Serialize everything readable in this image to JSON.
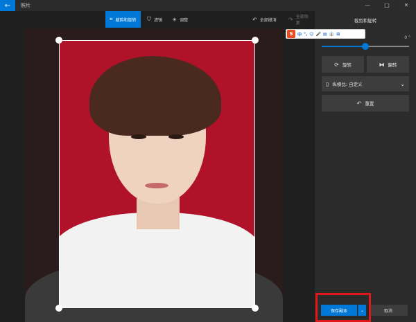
{
  "window": {
    "title": "照片",
    "back_icon": "←",
    "minimize": "—",
    "maximize": "□",
    "close": "✕"
  },
  "toolbar": {
    "crop_rotate": "裁剪和旋转",
    "filter": "滤镜",
    "adjust": "调整",
    "undo_all": "全部撤消",
    "redo_all": "全部恢复"
  },
  "ime": {
    "logo": "S",
    "items": [
      "中",
      "°,",
      "☺",
      "🎤",
      "▤",
      "👔",
      "⊞"
    ]
  },
  "panel": {
    "title": "裁剪和旋转",
    "angle": "0 °",
    "rotate_label": "旋转",
    "flip_label": "翻转",
    "aspect_label": "纵横比: 自定义",
    "reset_label": "重置",
    "slider_value": 0.5
  },
  "footer": {
    "save_copy": "保存副本",
    "cancel": "取消"
  },
  "colors": {
    "accent": "#0078d7",
    "highlight": "#e01818",
    "photo_bg": "#b0122a"
  }
}
